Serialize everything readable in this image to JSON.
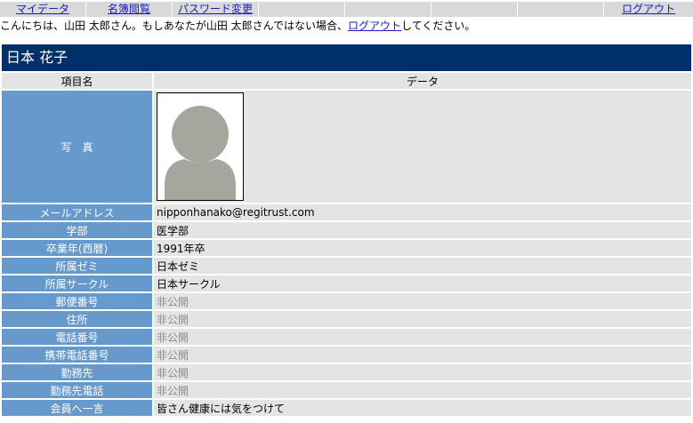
{
  "nav": {
    "items": [
      {
        "label": "マイデータ"
      },
      {
        "label": "名簿閲覧"
      },
      {
        "label": "パスワード変更"
      }
    ],
    "logout_label": "ログアウト"
  },
  "greeting": {
    "prefix": "こんにちは、山田 太郎さん。もしあなたが山田 太郎さんではない場合、",
    "logout_link": "ログアウト",
    "suffix": "してください。"
  },
  "profile": {
    "name": "日本 花子",
    "header": {
      "item": "項目名",
      "data": "データ"
    },
    "photo_label": "写　真",
    "rows": [
      {
        "label": "メールアドレス",
        "value": "nipponhanako@regitrust.com"
      },
      {
        "label": "学部",
        "value": "医学部"
      },
      {
        "label": "卒業年(西暦)",
        "value": "1991年卒"
      },
      {
        "label": "所属ゼミ",
        "value": "日本ゼミ"
      },
      {
        "label": "所属サークル",
        "value": "日本サークル"
      },
      {
        "label": "郵便番号",
        "value": "非公開"
      },
      {
        "label": "住所",
        "value": "非公開"
      },
      {
        "label": "電話番号",
        "value": "非公開"
      },
      {
        "label": "携帯電話番号",
        "value": "非公開"
      },
      {
        "label": "勤務先",
        "value": "非公開"
      },
      {
        "label": "勤務先電話",
        "value": "非公開"
      },
      {
        "label": "会員へ一言",
        "value": "皆さん健康には気をつけて"
      }
    ]
  },
  "colors": {
    "nav_bg": "#d9d9d9",
    "link": "#1a1acc",
    "name_bar": "#002f6c",
    "label_bg": "#6699cc",
    "value_bg": "#e4e4e4",
    "private_text": "#8c8c8c"
  },
  "icons": {
    "photo": "default-avatar-silhouette"
  }
}
